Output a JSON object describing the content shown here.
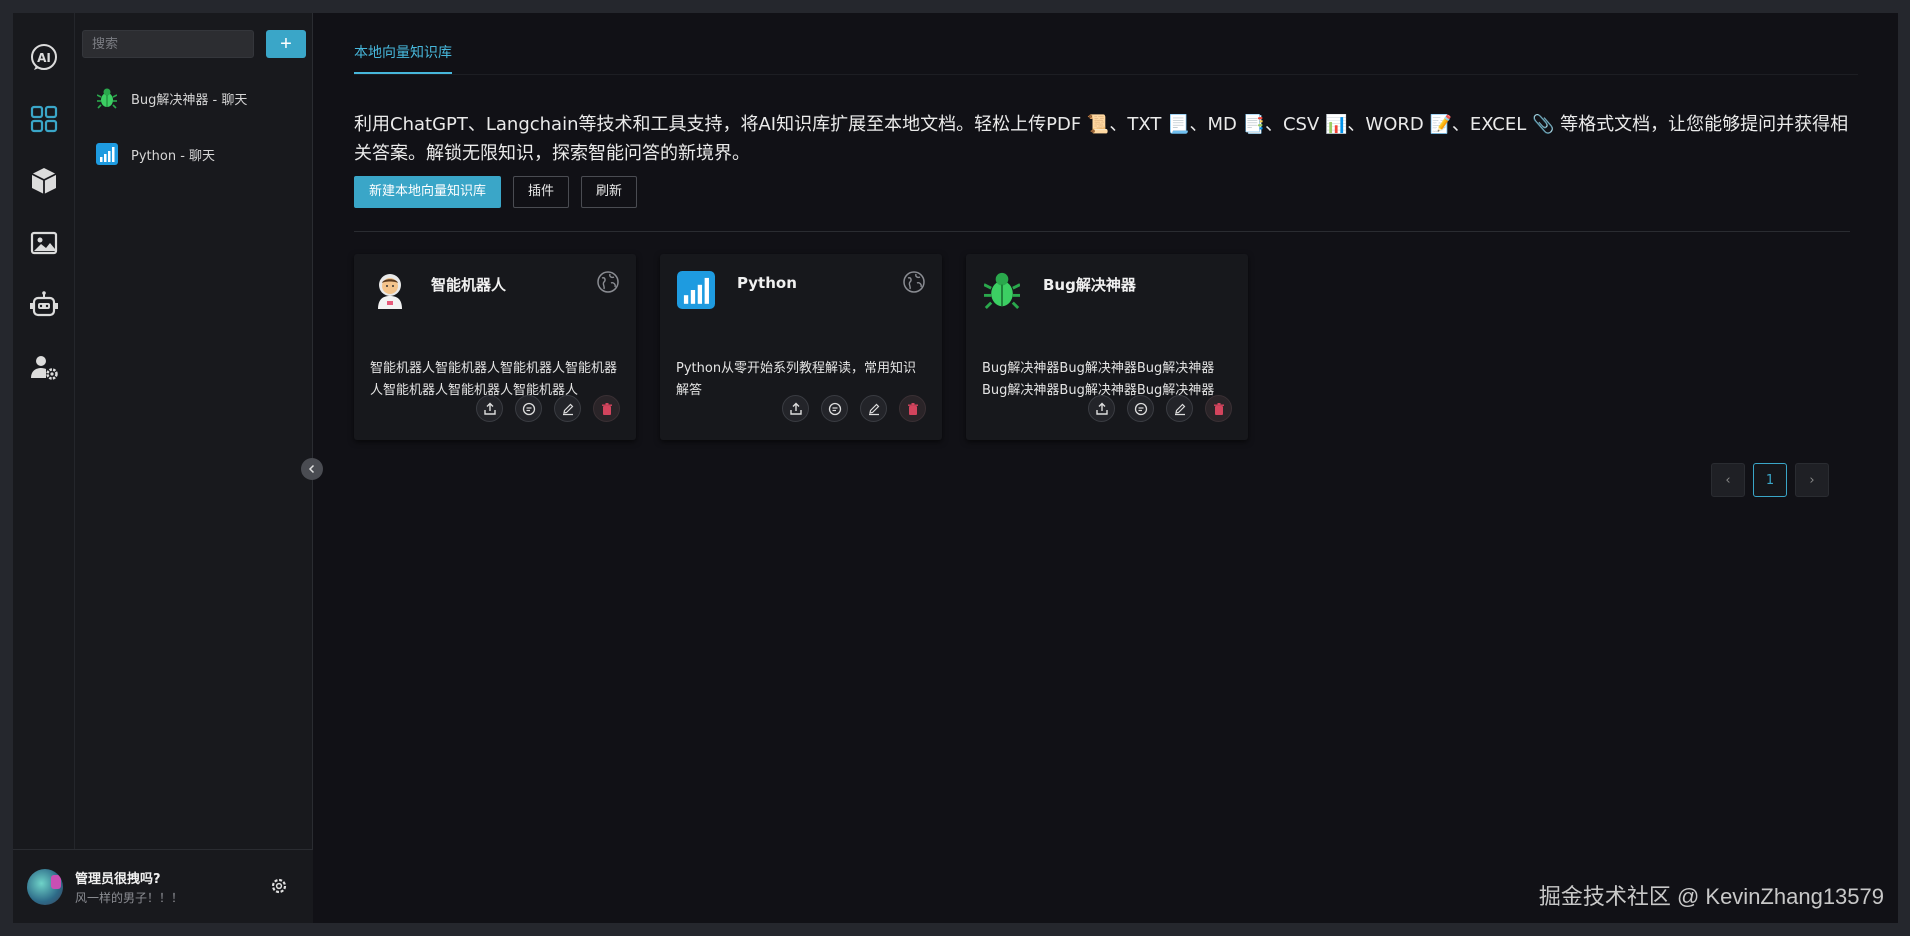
{
  "search": {
    "placeholder": "搜索"
  },
  "add_button": {
    "label": "+"
  },
  "sessions": [
    {
      "label": "Bug解决神器 - 聊天",
      "icon": "bug-icon"
    },
    {
      "label": "Python - 聊天",
      "icon": "python-bars-icon"
    }
  ],
  "rail": [
    "ai-chat-icon",
    "apps-grid-icon",
    "cube-icon",
    "image-icon",
    "robot-icon",
    "user-settings-icon"
  ],
  "user": {
    "name": "管理员很拽吗?",
    "motto": "风一样的男子！！！"
  },
  "tab": {
    "label": "本地向量知识库"
  },
  "description": "利用ChatGPT、Langchain等技术和工具支持，将AI知识库扩展至本地文档。轻松上传PDF 📜、TXT 📃、MD 📑、CSV 📊、WORD 📝、EXCEL 📎 等格式文档，让您能够提问并获得相关答案。解锁无限知识，探索智能问答的新境界。",
  "buttons": {
    "create": "新建本地向量知识库",
    "plugin": "插件",
    "refresh": "刷新"
  },
  "cards": [
    {
      "title": "智能机器人",
      "icon": "astronaut-icon",
      "desc": "智能机器人智能机器人智能机器人智能机器人智能机器人智能机器人智能机器人"
    },
    {
      "title": "Python",
      "icon": "python-bars-icon",
      "desc": "Python从零开始系列教程解读，常用知识解答"
    },
    {
      "title": "Bug解决神器",
      "icon": "bug-icon",
      "desc": "Bug解决神器Bug解决神器Bug解决神器Bug解决神器Bug解决神器Bug解决神器"
    }
  ],
  "pagination": {
    "current": "1",
    "prev": "‹",
    "next": "›"
  },
  "watermark": "掘金技术社区 @ KevinZhang13579",
  "colors": {
    "accent": "#3aa6c8",
    "delete": "#d3445d",
    "background": "#111116"
  }
}
